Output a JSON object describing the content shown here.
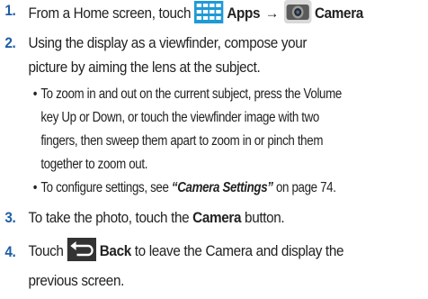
{
  "steps": [
    {
      "num": "1.",
      "text_a": "From a Home screen, touch",
      "apps": "Apps",
      "arrow": "→",
      "camera": "Camera"
    },
    {
      "num": "2.",
      "line1": "Using the display as a viewfinder, compose your",
      "line2": "picture by aiming the lens at the subject."
    },
    {
      "num": "3.",
      "text_a": "To take the photo, touch the",
      "bold": "Camera",
      "text_b": "button."
    },
    {
      "num": "4.",
      "text_a": "Touch",
      "bold": "Back",
      "text_b": "to leave the Camera and display the",
      "line2": "previous screen."
    }
  ],
  "bullets": [
    {
      "dot": "•",
      "lines": [
        "To zoom in and out on the current subject, press the Volume",
        "key Up or Down, or touch the viewfinder image with two",
        "fingers, then sweep them apart to zoom in or pinch them",
        "together to zoom out."
      ]
    },
    {
      "dot": "•",
      "text_a": "To configure settings, see",
      "ref": "“Camera Settings”",
      "text_b": "on page 74."
    }
  ],
  "icons": {
    "apps": "apps-grid-icon",
    "camera": "camera-icon",
    "back": "back-arrow-icon"
  },
  "colors": {
    "step_number": "#1f5ea6",
    "apps_icon": "#1f9ad6",
    "camera_icon": "#4a4a4a",
    "back_icon": "#333333"
  }
}
